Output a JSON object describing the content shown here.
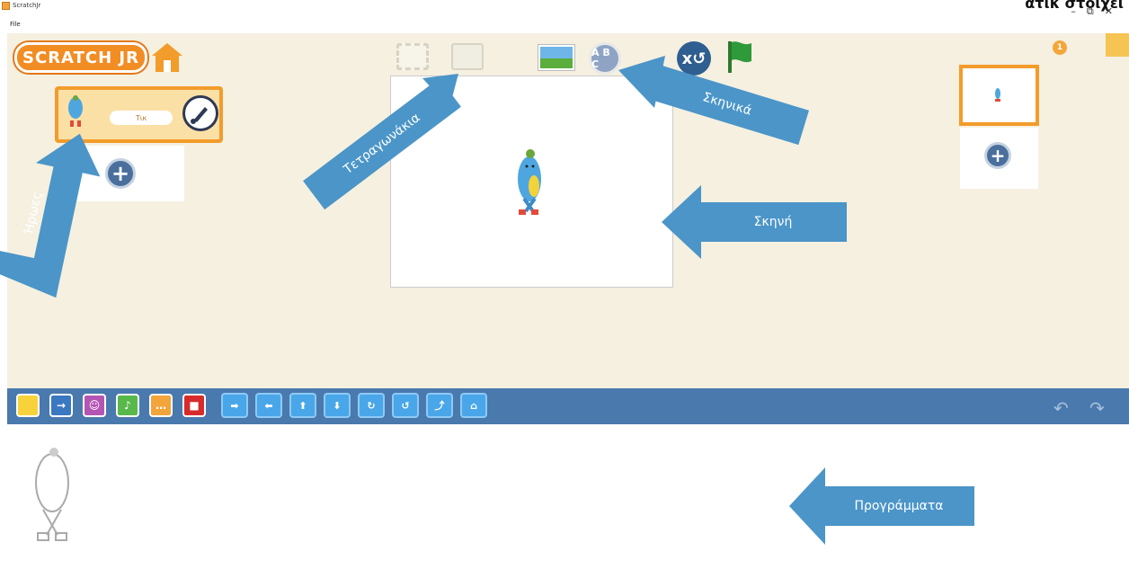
{
  "window": {
    "title": "ScratchJr",
    "corner_text": "ατικ στοιχεί",
    "minimize": "–",
    "restore": "⧉",
    "close": "✕"
  },
  "menu": {
    "file": "File"
  },
  "toolbar": {
    "logo": "SCRATCH JR",
    "text_button": "A B C",
    "reset_button": "x↺",
    "page_badge": "1"
  },
  "sprite": {
    "name": "Τικ"
  },
  "categories": [
    {
      "name": "triggering",
      "color": "#f7d23a",
      "glyph": ""
    },
    {
      "name": "motion",
      "color": "#3a78c2",
      "glyph": "→"
    },
    {
      "name": "looks",
      "color": "#b455b3",
      "glyph": "☺"
    },
    {
      "name": "sound",
      "color": "#58b94a",
      "glyph": "♪"
    },
    {
      "name": "control",
      "color": "#f3a43a",
      "glyph": "…"
    },
    {
      "name": "end",
      "color": "#d72b2b",
      "glyph": "■"
    }
  ],
  "motion_blocks": [
    {
      "name": "move-right",
      "glyph": "➡"
    },
    {
      "name": "move-left",
      "glyph": "⬅"
    },
    {
      "name": "move-up",
      "glyph": "⬆"
    },
    {
      "name": "move-down",
      "glyph": "⬇"
    },
    {
      "name": "turn-right",
      "glyph": "↻"
    },
    {
      "name": "turn-left",
      "glyph": "↺"
    },
    {
      "name": "hop",
      "glyph": "⤴"
    },
    {
      "name": "go-home",
      "glyph": "⌂"
    }
  ],
  "icons": {
    "undo": "↶",
    "redo": "↷",
    "plus": "+"
  },
  "annotations": {
    "heroes": "Ήρωες",
    "grid": "Τετραγωνάκια",
    "backgrounds": "Σκηνικά",
    "stage": "Σκηνή",
    "programs": "Προγράμματα"
  }
}
